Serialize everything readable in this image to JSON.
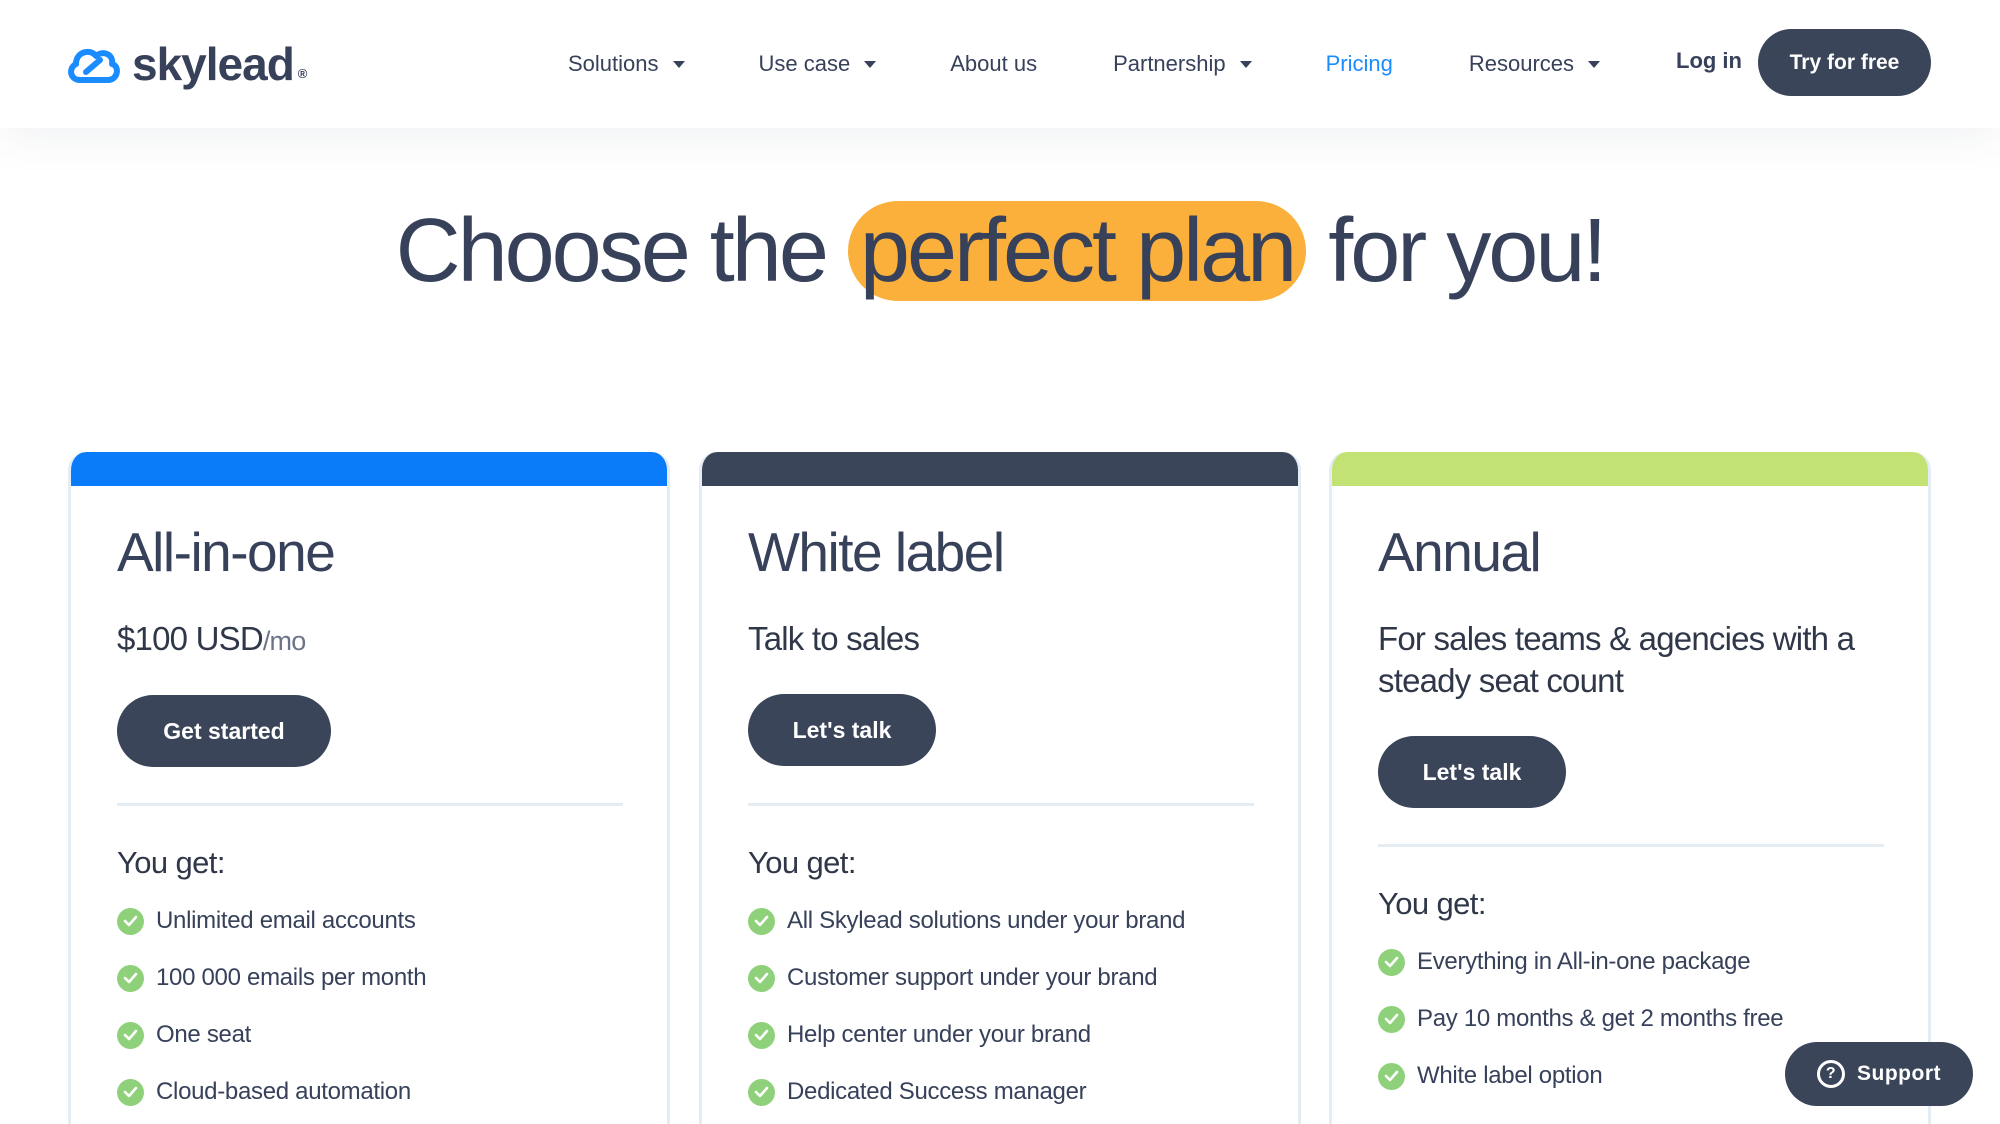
{
  "header": {
    "logo_text": "skylead",
    "logo_mark": "®",
    "nav": [
      {
        "label": "Solutions",
        "dropdown": true
      },
      {
        "label": "Use case",
        "dropdown": true
      },
      {
        "label": "About us",
        "dropdown": false
      },
      {
        "label": "Partnership",
        "dropdown": true
      },
      {
        "label": "Pricing",
        "dropdown": false,
        "active": true
      },
      {
        "label": "Resources",
        "dropdown": true
      }
    ],
    "login_label": "Log in",
    "try_label": "Try for free"
  },
  "hero": {
    "before": "Choose the",
    "highlight": "perfect plan",
    "after": "for you!"
  },
  "cards": [
    {
      "bar_color": "#0a7cf9",
      "title": "All-in-one",
      "price": "$100 USD",
      "per": "/mo",
      "button": "Get started",
      "you_get": "You get:",
      "features": [
        "Unlimited email accounts",
        "100 000 emails per month",
        "One seat",
        "Cloud-based automation"
      ]
    },
    {
      "bar_color": "#3b4559",
      "title": "White label",
      "subtitle": "Talk to sales",
      "button": "Let's talk",
      "you_get": "You get:",
      "features": [
        "All Skylead solutions under your brand",
        "Customer support under your brand",
        "Help center under your brand",
        "Dedicated Success manager"
      ]
    },
    {
      "bar_color": "#c2e373",
      "title": "Annual",
      "subtitle": "For sales teams & agencies with a steady seat count",
      "button": "Let's talk",
      "you_get": "You get:",
      "features": [
        "Everything in All-in-one package",
        "Pay 10 months & get 2 months free",
        "White label option"
      ]
    }
  ],
  "support": {
    "label": "Support"
  },
  "colors": {
    "accent": "#1a8cff",
    "highlight": "#fbb03b",
    "dark": "#3b4559",
    "check": "#8fd17a"
  },
  "icons": [
    "skylead-cloud-logo-icon",
    "chevron-down-icon",
    "check-circle-icon",
    "question-icon"
  ]
}
